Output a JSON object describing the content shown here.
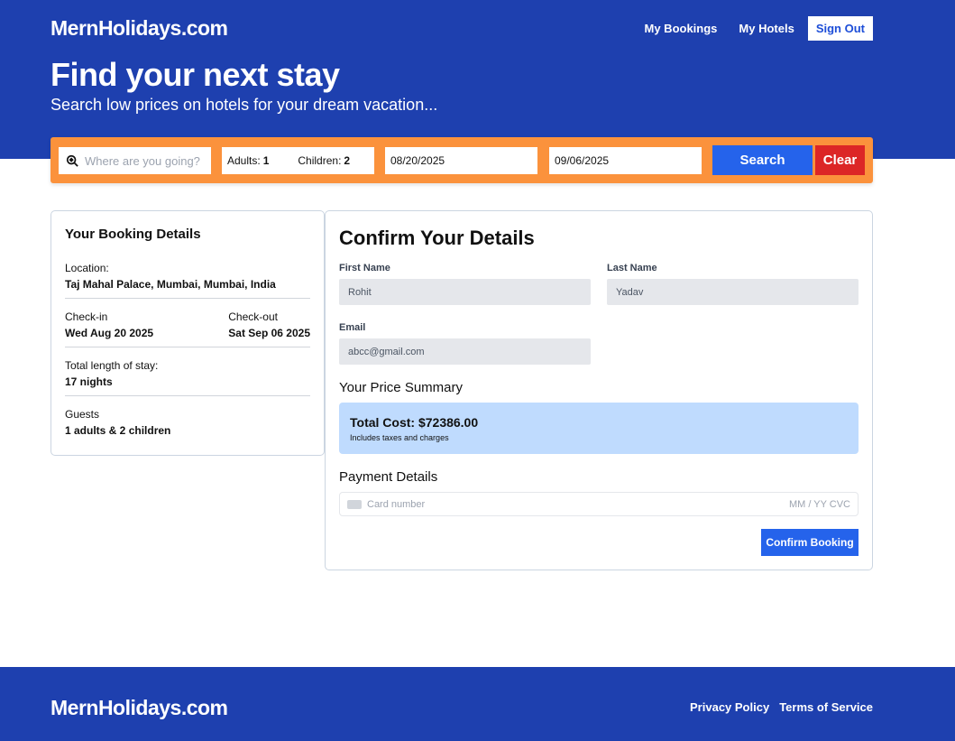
{
  "header": {
    "logo": "MernHolidays.com",
    "nav": {
      "bookings": "My Bookings",
      "hotels": "My Hotels",
      "signout": "Sign Out"
    },
    "title": "Find your next stay",
    "subtitle": "Search low prices on hotels for your dream vacation..."
  },
  "search": {
    "destination_placeholder": "Where are you going?",
    "adults_label": "Adults:",
    "adults_value": "1",
    "children_label": "Children:",
    "children_value": "2",
    "checkin": "08/20/2025",
    "checkout": "09/06/2025",
    "search_label": "Search",
    "clear_label": "Clear"
  },
  "booking": {
    "title": "Your Booking Details",
    "location_label": "Location:",
    "location_value": "Taj Mahal Palace, Mumbai, Mumbai, India",
    "checkin_label": "Check-in",
    "checkin_value": "Wed Aug 20 2025",
    "checkout_label": "Check-out",
    "checkout_value": "Sat Sep 06 2025",
    "stay_label": "Total length of stay:",
    "stay_value": "17 nights",
    "guests_label": "Guests",
    "guests_value": "1 adults & 2 children"
  },
  "confirm": {
    "title": "Confirm Your Details",
    "first_name_label": "First Name",
    "first_name_value": "Rohit",
    "last_name_label": "Last Name",
    "last_name_value": "Yadav",
    "email_label": "Email",
    "email_value": "abcc@gmail.com",
    "price_title": "Your Price Summary",
    "total_cost": "Total Cost: $72386.00",
    "price_note": "Includes taxes and charges",
    "payment_title": "Payment Details",
    "card_placeholder": "Card number",
    "card_exp_cvc": "MM / YY  CVC",
    "confirm_label": "Confirm Booking"
  },
  "footer": {
    "logo": "MernHolidays.com",
    "privacy": "Privacy Policy",
    "terms": "Terms of Service"
  },
  "colors": {
    "brand_blue": "#1e40af",
    "button_blue": "#2563eb",
    "search_orange": "#fb923c",
    "clear_red": "#dc2626",
    "price_box": "#bfdbfe"
  },
  "icons": {
    "destination": "map-search-icon",
    "card": "credit-card-icon"
  }
}
